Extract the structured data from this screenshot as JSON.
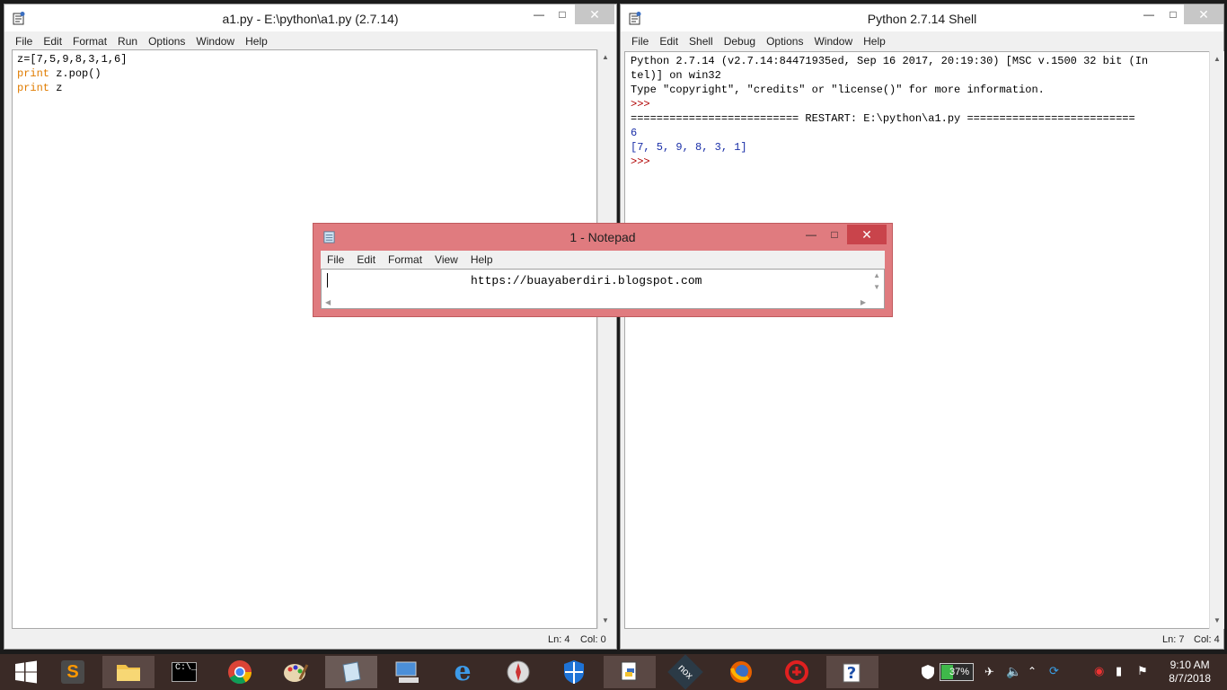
{
  "editor_window": {
    "title": "a1.py - E:\\python\\a1.py (2.7.14)",
    "menu": [
      "File",
      "Edit",
      "Format",
      "Run",
      "Options",
      "Window",
      "Help"
    ],
    "code": [
      {
        "kw": "",
        "text": "z=[7,5,9,8,3,1,6]"
      },
      {
        "kw": "print",
        "text": " z.pop()"
      },
      {
        "kw": "print",
        "text": " z"
      }
    ],
    "status_ln": "Ln: 4",
    "status_col": "Col: 0"
  },
  "shell_window": {
    "title": "Python 2.7.14 Shell",
    "menu": [
      "File",
      "Edit",
      "Shell",
      "Debug",
      "Options",
      "Window",
      "Help"
    ],
    "lines": [
      {
        "cls": "",
        "text": "Python 2.7.14 (v2.7.14:84471935ed, Sep 16 2017, 20:19:30) [MSC v.1500 32 bit (In"
      },
      {
        "cls": "",
        "text": "tel)] on win32"
      },
      {
        "cls": "",
        "text": "Type \"copyright\", \"credits\" or \"license()\" for more information."
      },
      {
        "cls": "err-prompt",
        "text": ">>>"
      },
      {
        "cls": "",
        "text": "========================== RESTART: E:\\python\\a1.py =========================="
      },
      {
        "cls": "out",
        "text": "6"
      },
      {
        "cls": "out",
        "text": "[7, 5, 9, 8, 3, 1]"
      },
      {
        "cls": "err-prompt",
        "text": ">>>"
      }
    ],
    "status_ln": "Ln: 7",
    "status_col": "Col: 4"
  },
  "notepad": {
    "title": "1 - Notepad",
    "menu": [
      "File",
      "Edit",
      "Format",
      "View",
      "Help"
    ],
    "content": "https://buayaberdiri.blogspot.com"
  },
  "window_buttons": {
    "minimize": "—",
    "maximize": "□",
    "close": "✕"
  },
  "taskbar": {
    "apps": [
      {
        "name": "start-button",
        "icon": "windows-logo-icon"
      },
      {
        "name": "sublime-text",
        "icon": "sublime-icon"
      },
      {
        "name": "file-explorer",
        "icon": "folder-icon"
      },
      {
        "name": "command-prompt",
        "icon": "terminal-icon"
      },
      {
        "name": "chrome",
        "icon": "chrome-icon"
      },
      {
        "name": "paint",
        "icon": "palette-icon"
      },
      {
        "name": "notepad",
        "icon": "notepad-icon"
      },
      {
        "name": "remote-desktop",
        "icon": "monitor-icon"
      },
      {
        "name": "internet-explorer",
        "icon": "ie-icon"
      },
      {
        "name": "compass",
        "icon": "compass-icon"
      },
      {
        "name": "windows-defender",
        "icon": "shield-icon"
      },
      {
        "name": "python-idle",
        "icon": "python-icon"
      },
      {
        "name": "nox",
        "icon": "nox-icon"
      },
      {
        "name": "firefox",
        "icon": "firefox-icon"
      },
      {
        "name": "garena",
        "icon": "garena-icon"
      },
      {
        "name": "help-file",
        "icon": "help-icon"
      }
    ],
    "battery": "37%",
    "time": "9:10 AM",
    "date": "8/7/2018"
  }
}
